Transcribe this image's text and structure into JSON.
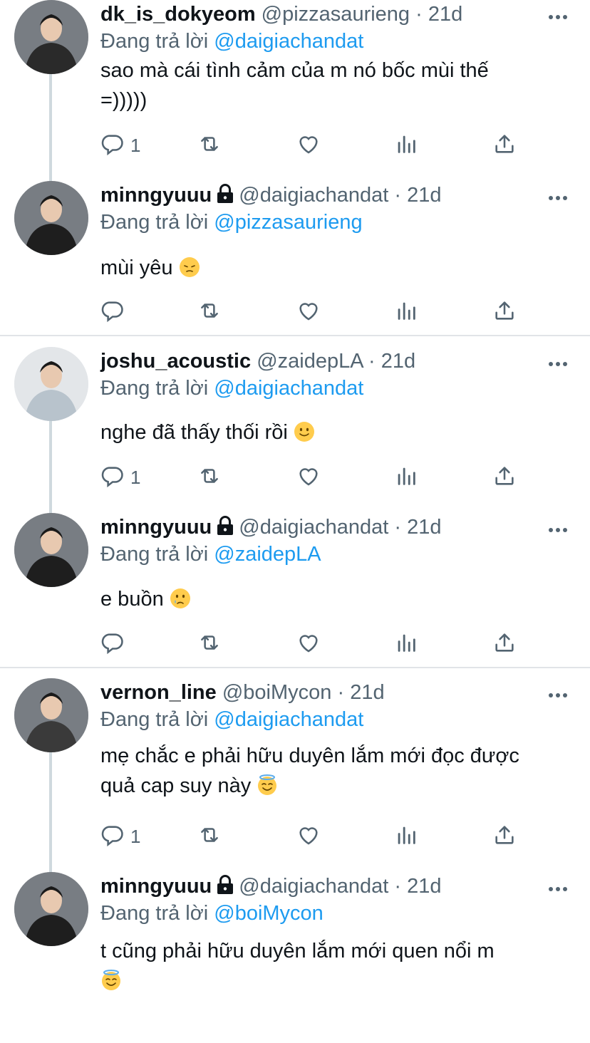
{
  "reply_prefix": "Đang trả lời",
  "tweets": [
    {
      "name": "dk_is_dokyeom",
      "handle": "@pizzasaurieng",
      "time": "21d",
      "locked": false,
      "reply_to": "@daigiachandat",
      "lines": [
        "sao mà cái tình cảm của m nó bốc mùi thế",
        "=)))))"
      ],
      "reply_count": "1",
      "avatar_color": "#2a2a2a"
    },
    {
      "name": "minngyuuu",
      "handle": "@daigiachandat",
      "time": "21d",
      "locked": true,
      "reply_to": "@pizzasaurieng",
      "lines": [
        "mùi yêu "
      ],
      "emoji": "pensive-face",
      "reply_count": "",
      "avatar_color": "#1e1e1e"
    },
    {
      "name": "joshu_acoustic",
      "handle": "@zaidepLA",
      "time": "21d",
      "locked": false,
      "reply_to": "@daigiachandat",
      "lines": [
        "nghe đã thấy thối rồi "
      ],
      "emoji": "slightly-smiling-face",
      "reply_count": "1",
      "avatar_color": "#b8c3cc"
    },
    {
      "name": "minngyuuu",
      "handle": "@daigiachandat",
      "time": "21d",
      "locked": true,
      "reply_to": "@zaidepLA",
      "lines": [
        "e buồn "
      ],
      "emoji": "crying-face",
      "reply_count": "",
      "avatar_color": "#1e1e1e"
    },
    {
      "name": "vernon_line",
      "handle": "@boiMycon",
      "time": "21d",
      "locked": false,
      "reply_to": "@daigiachandat",
      "lines": [
        "mẹ chắc e phải hữu duyên lắm mới đọc được",
        "quả cap suy này "
      ],
      "emoji": "halo-face",
      "reply_count": "1",
      "avatar_color": "#3a3a3a"
    },
    {
      "name": "minngyuuu",
      "handle": "@daigiachandat",
      "time": "21d",
      "locked": true,
      "reply_to": "@boiMycon",
      "lines": [
        "t cũng phải hữu duyên lắm mới quen nổi m",
        ""
      ],
      "emoji": "halo-face",
      "reply_count": "",
      "avatar_color": "#1e1e1e"
    }
  ],
  "colors": {
    "link": "#1d9bf0",
    "muted": "#536471",
    "text": "#0f1419",
    "thread_line": "#cfd9de"
  }
}
